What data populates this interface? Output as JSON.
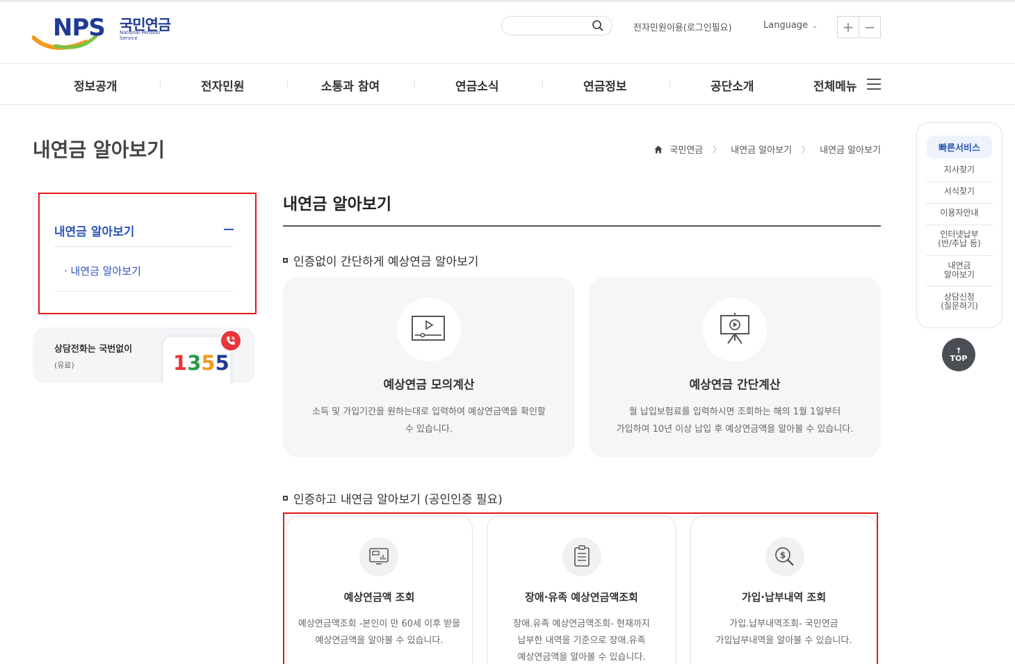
{
  "header": {
    "logo": {
      "nps": "NPS",
      "korean_name": "국민연금",
      "english_name": "National Pension Service"
    },
    "search_placeholder": "",
    "ecivil_label": "전자민원이용(로그인필요)",
    "language_label": "Language",
    "zoom_in": "+",
    "zoom_out": "−"
  },
  "nav": {
    "items": [
      "정보공개",
      "전자민원",
      "소통과 참여",
      "연금소식",
      "연금정보",
      "공단소개",
      "전체메뉴"
    ]
  },
  "page": {
    "title": "내연금 알아보기",
    "breadcrumb": [
      "국민연금",
      "내연금 알아보기",
      "내연금 알아보기"
    ]
  },
  "sidebar": {
    "menu_title": "내연금 알아보기",
    "sub_items": [
      "내연금 알아보기"
    ],
    "call": {
      "line1": "상담전화는 국번없이",
      "line2": "(유료)",
      "number": "1355"
    }
  },
  "content": {
    "section_title": "내연금 알아보기",
    "group1": {
      "heading": "인증없이 간단하게 예상연금 알아보기",
      "cards": [
        {
          "title": "예상연금 모의계산",
          "desc1": "소득 및 가입기간을 원하는대로 입력하여 예상연금액을 확인할",
          "desc2": "수 있습니다.",
          "icon": "monitor-play-icon"
        },
        {
          "title": "예상연금 간단계산",
          "desc1": "월 납입보험료를 입력하시면 조회하는 해의 1월 1일부터",
          "desc2": "가입하여 10년 이상 납입 후 예상연금액을 알아볼 수 있습니다.",
          "icon": "presentation-icon"
        }
      ]
    },
    "group2": {
      "heading": "인증하고 내연금 알아보기 (공인인증 필요)",
      "cards": [
        {
          "title": "예상연금액 조회",
          "desc1": "예상연금액조회 -본인이 만 60세 이후 받을",
          "desc2": "예상연금액을 알아볼 수 있습니다.",
          "desc3": "",
          "icon": "monitor-chart-icon"
        },
        {
          "title": "장애·유족 예상연금액조회",
          "desc1": "장애.유족 예상연금액조회- 현재까지",
          "desc2": "납부한 내역을 기준으로 장애.유족",
          "desc3": "예상연금액을 알아볼 수 있습니다.",
          "icon": "document-list-icon"
        },
        {
          "title": "가입·납부내역 조회",
          "desc1": "가입.납부내역조회- 국민연금",
          "desc2": "가입납부내역을 알아볼 수 있습니다.",
          "desc3": "",
          "icon": "search-dollar-icon"
        }
      ]
    }
  },
  "quick_service": {
    "title": "빠른서비스",
    "items": [
      {
        "l1": "지사찾기",
        "l2": ""
      },
      {
        "l1": "서식찾기",
        "l2": ""
      },
      {
        "l1": "이용자안내",
        "l2": ""
      },
      {
        "l1": "인터넷납부",
        "l2": "(반/추납 등)"
      },
      {
        "l1": "내연금",
        "l2": "알아보기"
      },
      {
        "l1": "상담신청",
        "l2": "(질문하기)"
      }
    ],
    "top_label": "TOP"
  },
  "colors": {
    "brand_blue": "#1f3b93",
    "link_blue": "#2b54b8",
    "highlight_red": "#e31818",
    "call_red": "#e9363c"
  }
}
